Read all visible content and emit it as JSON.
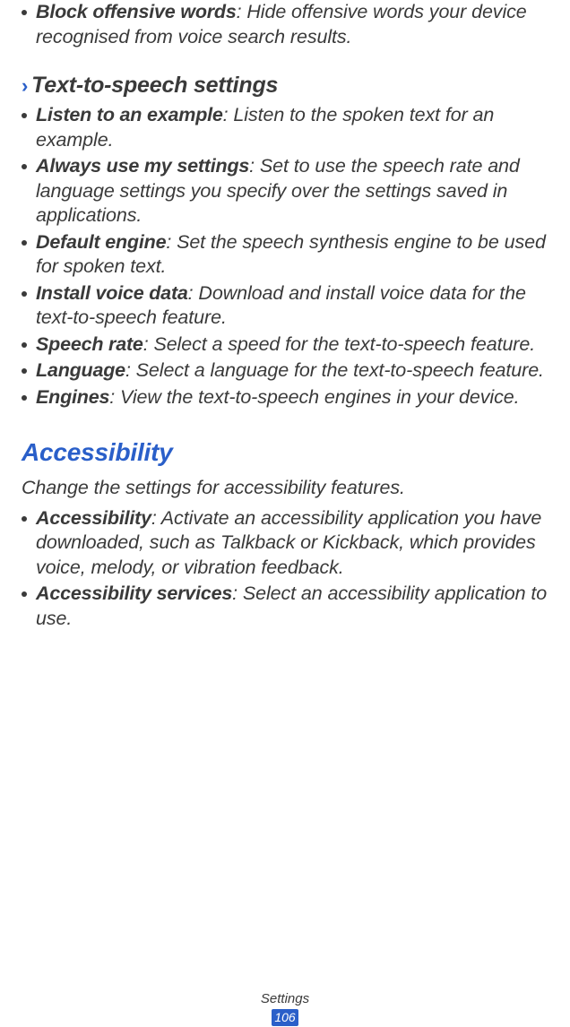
{
  "top_block": {
    "term": "Block offensive words",
    "desc": ": Hide offensive words your device recognised from voice search results."
  },
  "tts_heading": "Text-to-speech settings",
  "tts_items": [
    {
      "term": "Listen to an example",
      "desc": ": Listen to the spoken text for an example."
    },
    {
      "term": "Always use my settings",
      "desc": ": Set to use the speech rate and language settings you specify over the settings saved in applications."
    },
    {
      "term": "Default engine",
      "desc": ": Set the speech synthesis engine to be used for spoken text."
    },
    {
      "term": "Install voice data",
      "desc": ": Download and install voice data for the text-to-speech feature."
    },
    {
      "term": "Speech rate",
      "desc": ": Select a speed for the text-to-speech feature."
    },
    {
      "term": "Language",
      "desc": ": Select a language for the text-to-speech feature."
    },
    {
      "term": "Engines",
      "desc": ": View the text-to-speech engines in your device."
    }
  ],
  "accessibility_title": "Accessibility",
  "accessibility_intro": "Change the settings for accessibility features.",
  "accessibility_items": [
    {
      "term": "Accessibility",
      "desc": ": Activate an accessibility application you have downloaded, such as Talkback or Kickback, which provides voice, melody, or vibration feedback."
    },
    {
      "term": "Accessibility services",
      "desc": ": Select an accessibility application to use."
    }
  ],
  "footer_label": "Settings",
  "page_number": "106"
}
